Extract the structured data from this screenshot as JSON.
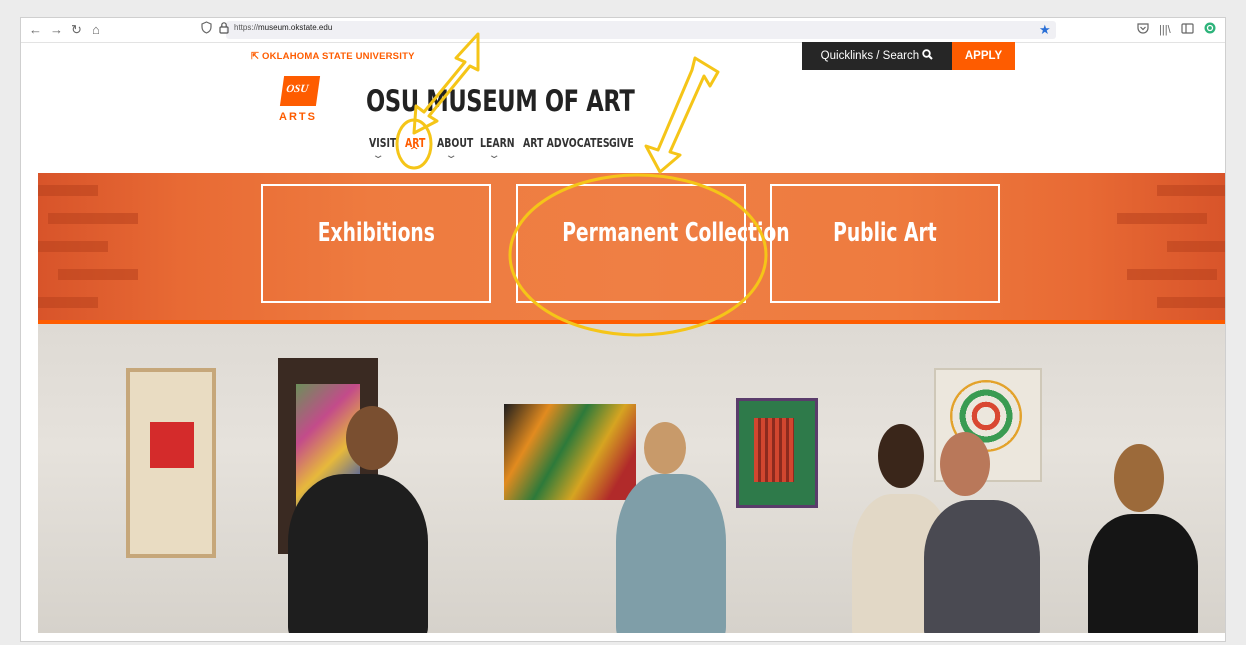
{
  "browser": {
    "url_prefix": "https://",
    "url_domain": "museum.okstate.edu",
    "icons": [
      "back-icon",
      "forward-icon",
      "reload-icon",
      "home-icon",
      "shield-icon",
      "lock-icon",
      "bookmark-star-icon",
      "pocket-icon",
      "library-icon",
      "sidebar-icon",
      "account-icon"
    ]
  },
  "header": {
    "university": "OKLAHOMA STATE UNIVERSITY",
    "logo_text": "OSU",
    "logo_sub": "ARTS",
    "title": "OSU MUSEUM OF ART",
    "quicklinks": "Quicklinks / Search",
    "apply": "APPLY"
  },
  "nav": {
    "items": [
      {
        "label": "VISIT",
        "chevron": "down"
      },
      {
        "label": "ART",
        "chevron": "up",
        "active": true
      },
      {
        "label": "ABOUT",
        "chevron": "down"
      },
      {
        "label": "LEARN",
        "chevron": "down"
      },
      {
        "label": "ART ADVOCATES"
      },
      {
        "label": "GIVE"
      }
    ]
  },
  "banner": {
    "tiles": [
      {
        "label": "Exhibitions"
      },
      {
        "label": "Permanent Collection"
      },
      {
        "label": "Public Art"
      }
    ]
  },
  "colors": {
    "brand_orange": "#fe5c00",
    "annotation_yellow": "#f5c518",
    "dark": "#262626"
  }
}
